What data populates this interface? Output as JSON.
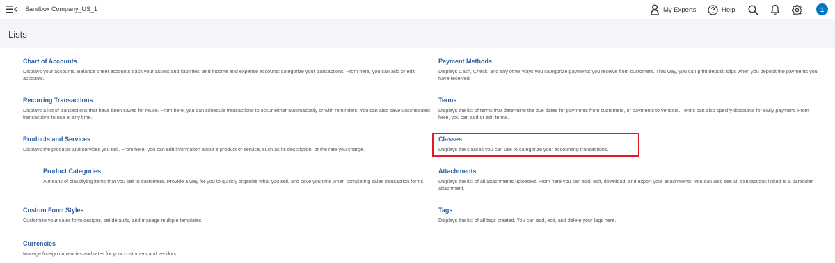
{
  "topbar": {
    "company_name": "Sandbox Company_US_1",
    "my_experts_label": "My Experts",
    "help_label": "Help",
    "avatar_initial": "1",
    "icons": [
      "menu-toggle-icon",
      "my-experts-icon",
      "help-icon",
      "search-icon",
      "bell-icon",
      "gear-icon"
    ]
  },
  "page": {
    "title": "Lists"
  },
  "lists": {
    "chart_of_accounts": {
      "title": "Chart of Accounts",
      "desc": "Displays your accounts. Balance sheet accounts track your assets and liabilities, and income and expense accounts categorize your transactions. From here, you can add or edit accounts."
    },
    "recurring_transactions": {
      "title": "Recurring Transactions",
      "desc": "Displays a list of transactions that have been saved for reuse. From here, you can schedule transactions to occur either automatically or with reminders. You can also save unscheduled transactions to use at any time."
    },
    "products_and_services": {
      "title": "Products and Services",
      "desc": "Displays the products and services you sell. From here, you can edit information about a product or service, such as its description, or the rate you charge."
    },
    "product_categories": {
      "title": "Product Categories",
      "desc": "A means of classifying items that you sell to customers. Provide a way for you to quickly organize what you sell, and save you time when completing sales transaction forms."
    },
    "custom_form_styles": {
      "title": "Custom Form Styles",
      "desc": "Customize your sales form designs, set defaults, and manage multiple templates."
    },
    "currencies": {
      "title": "Currencies",
      "desc": "Manage foreign currencies and rates for your customers and vendors."
    },
    "payment_methods": {
      "title": "Payment Methods",
      "desc": "Displays Cash, Check, and any other ways you categorize payments you receive from customers. That way, you can print deposit slips when you deposit the payments you have received."
    },
    "terms": {
      "title": "Terms",
      "desc": "Displays the list of terms that determine the due dates for payments from customers, or payments to vendors. Terms can also specify discounts for early payment. From here, you can add or edit terms."
    },
    "classes": {
      "title": "Classes",
      "desc": "Displays the classes you can use to categorize your accounting transactions."
    },
    "attachments": {
      "title": "Attachments",
      "desc": "Displays the list of all attachments uploaded. From here you can add, edit, download, and export your attachments. You can also see all transactions linked to a particular attachment."
    },
    "tags": {
      "title": "Tags",
      "desc": "Displays the list of all tags created. You can add, edit, and delete your tags here."
    }
  },
  "colors": {
    "link": "#2b5c9e",
    "text": "#393a3d",
    "header_bg": "#f4f5f8",
    "avatar_bg": "#0077c5",
    "highlight_border": "#e01b24"
  }
}
